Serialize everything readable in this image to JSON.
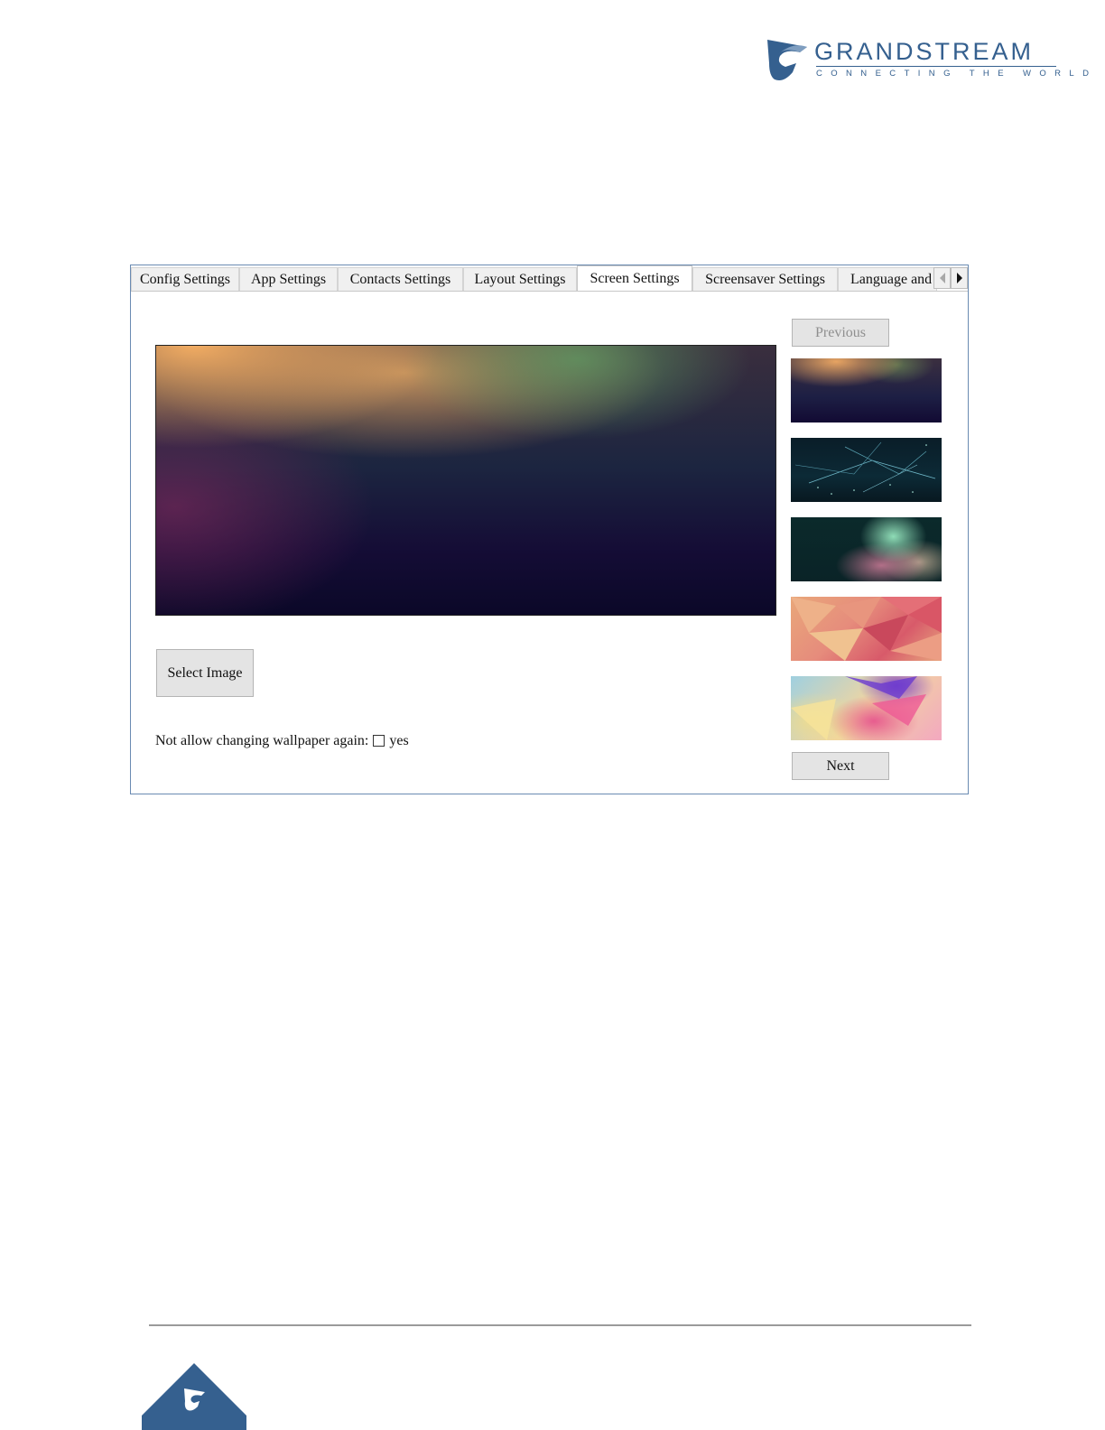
{
  "header": {
    "brand": "GRANDSTREAM",
    "tagline": "CONNECTING THE WORLD"
  },
  "colors": {
    "brand_blue": "#35608f",
    "window_border": "#6a8bb2"
  },
  "tabs": [
    {
      "label": "Config Settings"
    },
    {
      "label": "App Settings"
    },
    {
      "label": "Contacts Settings"
    },
    {
      "label": "Layout Settings"
    },
    {
      "label": "Screen Settings",
      "active": true
    },
    {
      "label": "Screensaver Settings"
    },
    {
      "label": "Language and"
    }
  ],
  "tab_scroll": {
    "left_icon": "triangle-left-icon",
    "right_icon": "triangle-right-icon"
  },
  "screen_settings": {
    "select_image_label": "Select Image",
    "lock_label": "Not allow changing wallpaper again:",
    "lock_option": "yes",
    "lock_checked": false,
    "previous_label": "Previous",
    "next_label": "Next",
    "thumbnail_count_visible": 5
  }
}
